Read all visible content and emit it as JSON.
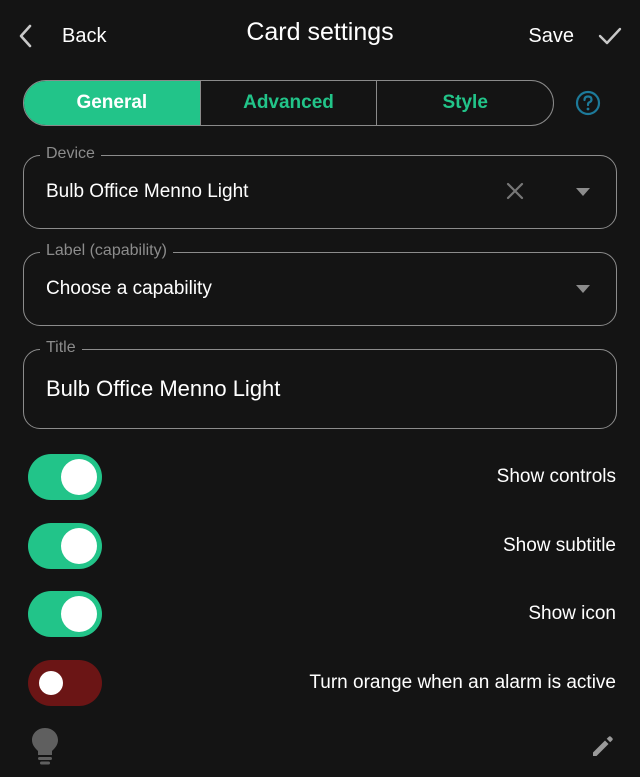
{
  "header": {
    "back_label": "Back",
    "title": "Card settings",
    "save_label": "Save"
  },
  "tabs": [
    {
      "label": "General",
      "active": true
    },
    {
      "label": "Advanced",
      "active": false
    },
    {
      "label": "Style",
      "active": false
    }
  ],
  "fields": {
    "device": {
      "legend": "Device",
      "value": "Bulb Office Menno Light"
    },
    "label": {
      "legend": "Label (capability)",
      "placeholder": "Choose a capability"
    },
    "title": {
      "legend": "Title",
      "value": "Bulb Office Menno Light"
    }
  },
  "toggles": [
    {
      "label": "Show controls",
      "on": true
    },
    {
      "label": "Show subtitle",
      "on": true
    },
    {
      "label": "Show icon",
      "on": true
    },
    {
      "label": "Turn orange when an alarm is active",
      "on": false
    }
  ],
  "icons": [
    "chevron-left-icon",
    "check-icon",
    "help-icon",
    "close-icon",
    "dropdown-arrow-icon",
    "lightbulb-icon",
    "pencil-icon"
  ],
  "colors": {
    "accent": "#22c489",
    "background": "#141414",
    "toggle_off": "#6b1515",
    "border": "#8c8c8c"
  }
}
